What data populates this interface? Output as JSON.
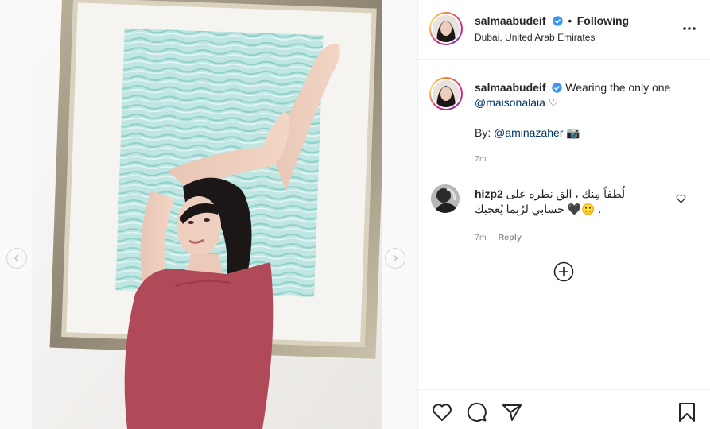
{
  "post": {
    "author": "salmaabudeif",
    "separator": "•",
    "follow_state": "Following",
    "location": "Dubai, United Arab Emirates",
    "more_icon": "more-horizontal-icon"
  },
  "caption": {
    "username": "salmaabudeif",
    "text": "Wearing the only one",
    "mention": "@maisonalaia",
    "emoji": "♡",
    "credit_prefix": "By:",
    "credit_mention": "@aminazaher",
    "credit_emoji": "📷",
    "time": "7m"
  },
  "comments": [
    {
      "username": "hizp2",
      "line1": "لُطفاً مِنك ، الق نظره على",
      "line2": "حسابي لرُبما يُعجبك",
      "emojis": "🖤🙁",
      "line2_end": ".",
      "time": "7m",
      "reply_label": "Reply"
    }
  ],
  "load_more_icon": "plus-circle-icon",
  "colors": {
    "verified": "#3897f0",
    "link": "#00376b",
    "meta": "#8e8e8e",
    "dress": "#b14a58"
  }
}
